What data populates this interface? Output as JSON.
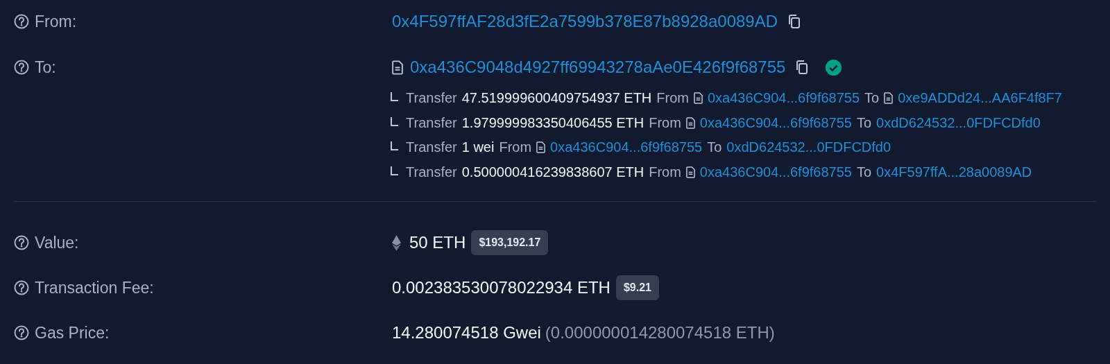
{
  "from": {
    "label": "From:",
    "address": "0x4F597ffAF28d3fE2a7599b378E87b8928a0089AD",
    "contract": false,
    "copyable": true,
    "verified": false
  },
  "to": {
    "label": "To:",
    "address": "0xa436C9048d4927ff69943278aAe0E426f9f68755",
    "contract": true,
    "copyable": true,
    "verified": true
  },
  "transfers": [
    {
      "word": "Transfer",
      "amount": "47.519999600409754937 ETH",
      "from_word": "From",
      "from": {
        "address": "0xa436C904...6f9f68755",
        "contract": true
      },
      "to_word": "To",
      "to": {
        "address": "0xe9ADDd24...AA6F4f8F7",
        "contract": true
      }
    },
    {
      "word": "Transfer",
      "amount": "1.979999983350406455 ETH",
      "from_word": "From",
      "from": {
        "address": "0xa436C904...6f9f68755",
        "contract": true
      },
      "to_word": "To",
      "to": {
        "address": "0xdD624532...0FDFCDfd0",
        "contract": false
      }
    },
    {
      "word": "Transfer",
      "amount": "1 wei",
      "from_word": "From",
      "from": {
        "address": "0xa436C904...6f9f68755",
        "contract": true
      },
      "to_word": "To",
      "to": {
        "address": "0xdD624532...0FDFCDfd0",
        "contract": false
      }
    },
    {
      "word": "Transfer",
      "amount": "0.500000416239838607 ETH",
      "from_word": "From",
      "from": {
        "address": "0xa436C904...6f9f68755",
        "contract": true
      },
      "to_word": "To",
      "to": {
        "address": "0x4F597ffA...28a0089AD",
        "contract": false
      }
    }
  ],
  "value": {
    "label": "Value:",
    "amount": "50 ETH",
    "usd": "$193,192.17"
  },
  "fee": {
    "label": "Transaction Fee:",
    "amount": "0.002383530078022934 ETH",
    "usd": "$9.21"
  },
  "gas": {
    "label": "Gas Price:",
    "amount": "14.280074518 Gwei",
    "detail": "(0.000000014280074518 ETH)"
  }
}
